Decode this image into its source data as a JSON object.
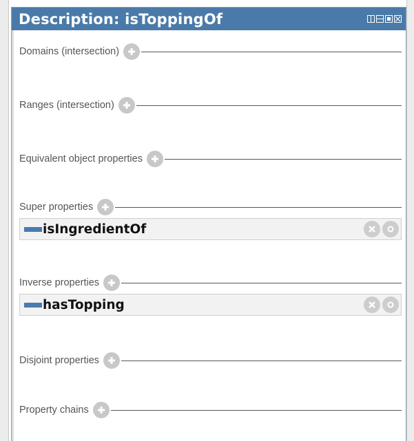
{
  "header": {
    "title": "Description: isToppingOf"
  },
  "sections": [
    {
      "label": "Domains (intersection)"
    },
    {
      "label": "Ranges (intersection)"
    },
    {
      "label": "Equivalent object properties"
    },
    {
      "label": "Super properties"
    },
    {
      "label": "Inverse properties"
    },
    {
      "label": "Disjoint properties"
    },
    {
      "label": "Property chains"
    }
  ],
  "super_properties": {
    "items": [
      {
        "name": "isIngredientOf"
      }
    ]
  },
  "inverse_properties": {
    "items": [
      {
        "name": "hasTopping"
      }
    ]
  },
  "colors": {
    "title_bar": "#4a7aa9",
    "property_swatch": "#4a7bb0",
    "add_button": "#c8c8c8"
  },
  "icons": {
    "add": "plus-circle-icon",
    "delete": "close-circle-icon",
    "edit": "dot-circle-icon",
    "window_controls": [
      "split-vertical-icon",
      "split-horizontal-icon",
      "maximize-icon",
      "close-icon"
    ]
  }
}
